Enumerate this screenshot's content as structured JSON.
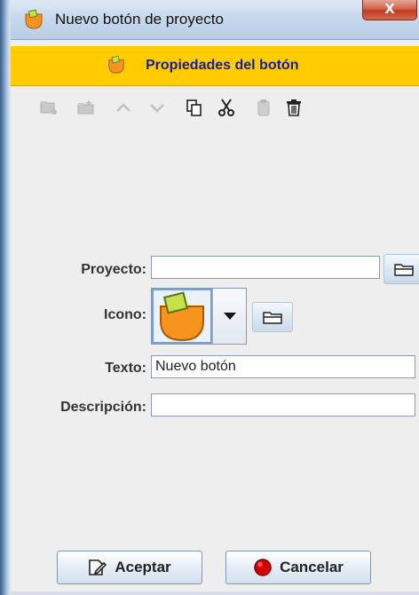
{
  "window": {
    "title": "Nuevo botón de proyecto",
    "close_label": "X"
  },
  "banner": {
    "title": "Propiedades del botón"
  },
  "toolbar": {
    "items": [
      {
        "icon": "new-project-icon",
        "enabled": false
      },
      {
        "icon": "new-folder-icon",
        "enabled": false
      },
      {
        "icon": "move-up-icon",
        "enabled": false
      },
      {
        "icon": "move-down-icon",
        "enabled": false
      },
      {
        "icon": "copy-icon",
        "enabled": true
      },
      {
        "icon": "cut-icon",
        "enabled": true
      },
      {
        "icon": "paste-icon",
        "enabled": false
      },
      {
        "icon": "delete-icon",
        "enabled": true
      }
    ]
  },
  "form": {
    "project": {
      "label": "Proyecto:",
      "value": ""
    },
    "icon": {
      "label": "Icono:"
    },
    "text": {
      "label": "Texto:",
      "value": "Nuevo botón"
    },
    "description": {
      "label": "Descripción:",
      "value": ""
    }
  },
  "buttons": {
    "accept": "Aceptar",
    "cancel": "Cancelar"
  },
  "colors": {
    "banner": "#ffcc00",
    "banner_text": "#1a1a99",
    "icon_orange": "#f7941d",
    "icon_green": "#c5e04a"
  }
}
